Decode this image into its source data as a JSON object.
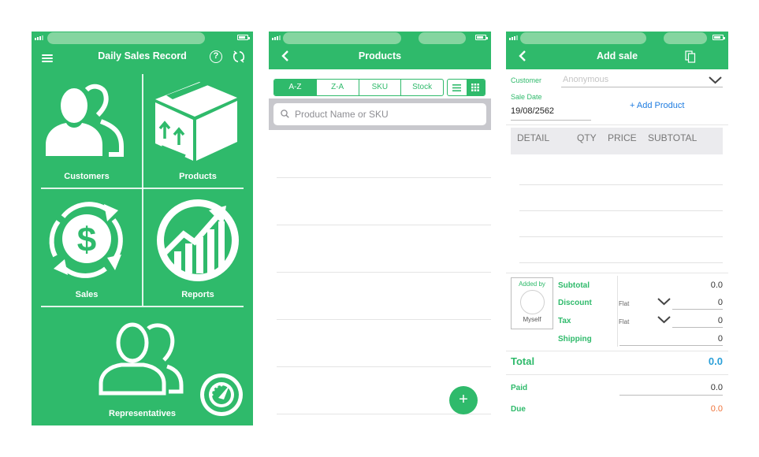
{
  "home": {
    "title": "Daily Sales Record",
    "help_glyph": "?",
    "tiles": {
      "customers": "Customers",
      "products": "Products",
      "sales": "Sales",
      "reports": "Reports",
      "representatives": "Representatives"
    }
  },
  "products": {
    "title": "Products",
    "sort_tabs": [
      "A-Z",
      "Z-A",
      "SKU",
      "Stock"
    ],
    "active_sort": "A-Z",
    "active_view": "grid",
    "search_placeholder": "Product Name or SKU",
    "fab_label": "+"
  },
  "add_sale": {
    "title": "Add sale",
    "customer_label": "Customer",
    "customer_placeholder": "Anonymous",
    "sale_date_label": "Sale Date",
    "sale_date_value": "19/08/2562",
    "add_product_label": "+ Add Product",
    "table_headers": {
      "detail": "DETAIL",
      "qty": "QTY",
      "price": "PRICE",
      "subtotal": "SUBTOTAL"
    },
    "added_by_label": "Added by",
    "added_by_name": "Myself",
    "subtotal_label": "Subtotal",
    "subtotal_value": "0.0",
    "discount_label": "Discount",
    "discount_type": "Flat",
    "discount_value": "0",
    "tax_label": "Tax",
    "tax_type": "Flat",
    "tax_value": "0",
    "shipping_label": "Shipping",
    "shipping_value": "0",
    "total_label": "Total",
    "total_value": "0.0",
    "paid_label": "Paid",
    "paid_value": "0.0",
    "due_label": "Due",
    "due_value": "0.0"
  },
  "colors": {
    "brand_green": "#2fba6b",
    "total_blue": "#2a9fd8",
    "due_orange": "#f0733a",
    "link_blue": "#1e7ce0"
  },
  "icons": [
    "menu-icon",
    "help-icon",
    "refresh-icon",
    "customers-icon",
    "products-box-icon",
    "sales-dollar-icon",
    "reports-chart-icon",
    "representatives-icon",
    "speedometer-icon",
    "back-chevron-icon",
    "list-view-icon",
    "grid-view-icon",
    "search-icon",
    "copy-icon",
    "chevron-down-icon"
  ]
}
